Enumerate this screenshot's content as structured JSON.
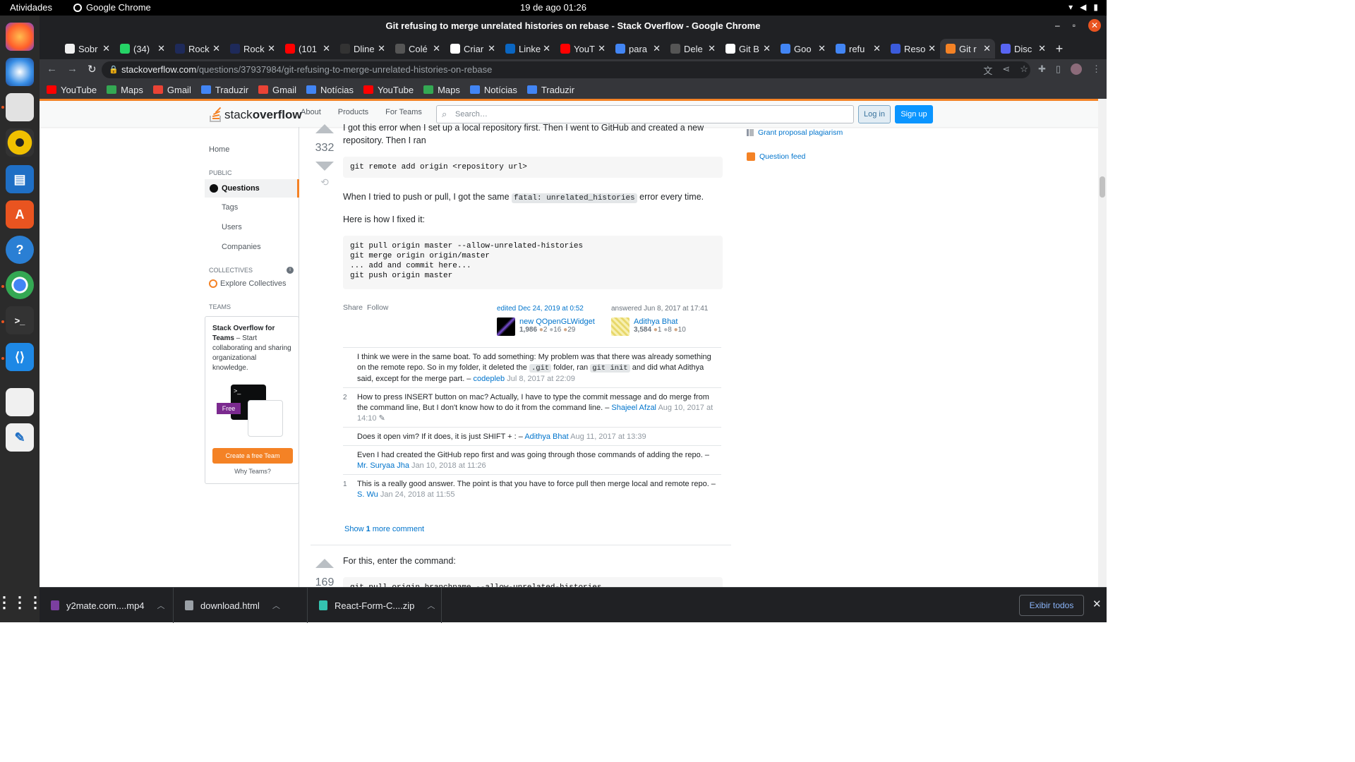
{
  "os": {
    "activities": "Atividades",
    "app_name": "Google Chrome",
    "clock": "19 de ago  01:26"
  },
  "window": {
    "title": "Git refusing to merge unrelated histories on rebase - Stack Overflow - Google Chrome"
  },
  "tabs": [
    {
      "label": "Sobr",
      "color": "#f0f0f0"
    },
    {
      "label": "(34)",
      "color": "#25d366"
    },
    {
      "label": "Rock",
      "color": "#1e2a5a"
    },
    {
      "label": "Rock",
      "color": "#1e2a5a"
    },
    {
      "label": "(101",
      "color": "#ff0000"
    },
    {
      "label": "Dline",
      "color": "#333333"
    },
    {
      "label": "Colé",
      "color": "#555555"
    },
    {
      "label": "Criar",
      "color": "#ffffff"
    },
    {
      "label": "Linke",
      "color": "#0a66c2"
    },
    {
      "label": "YouT",
      "color": "#ff0000"
    },
    {
      "label": "para",
      "color": "#4285f4"
    },
    {
      "label": "Dele",
      "color": "#555555"
    },
    {
      "label": "Git B",
      "color": "#ffffff"
    },
    {
      "label": "Goo",
      "color": "#4285f4"
    },
    {
      "label": "refu",
      "color": "#4285f4"
    },
    {
      "label": "Reso",
      "color": "#3b5bdb"
    },
    {
      "label": "Git r",
      "color": "#f48225"
    },
    {
      "label": "Disc",
      "color": "#5865f2"
    }
  ],
  "omnibox": {
    "host": "stackoverflow.com",
    "path": "/questions/37937984/git-refusing-to-merge-unrelated-histories-on-rebase"
  },
  "bookmarks": [
    {
      "label": "YouTube",
      "color": "#ff0000"
    },
    {
      "label": "Maps",
      "color": "#34a853"
    },
    {
      "label": "Gmail",
      "color": "#ea4335"
    },
    {
      "label": "Traduzir",
      "color": "#4285f4"
    },
    {
      "label": "Gmail",
      "color": "#ea4335"
    },
    {
      "label": "Notícias",
      "color": "#4285f4"
    },
    {
      "label": "YouTube",
      "color": "#ff0000"
    },
    {
      "label": "Maps",
      "color": "#34a853"
    },
    {
      "label": "Notícias",
      "color": "#4285f4"
    },
    {
      "label": "Traduzir",
      "color": "#4285f4"
    }
  ],
  "so": {
    "logo_light": "stack",
    "logo_bold": "overflow",
    "nav": [
      "About",
      "Products",
      "For Teams"
    ],
    "search_placeholder": "Search…",
    "login": "Log in",
    "signup": "Sign up"
  },
  "leftnav": {
    "home": "Home",
    "public": "PUBLIC",
    "questions": "Questions",
    "tags": "Tags",
    "users": "Users",
    "companies": "Companies",
    "collectives": "COLLECTIVES",
    "explore": "Explore Collectives",
    "teams": "TEAMS",
    "teams_title": "Stack Overflow for Teams",
    "teams_desc": " – Start collaborating and sharing organizational knowledge.",
    "free": "Free",
    "create_team": "Create a free Team",
    "why_teams": "Why Teams?"
  },
  "answer1": {
    "score": "332",
    "intro_a": "I got this error when I set up a local repository first. Then I went to GitHub and created a new repository. Then I ran",
    "code1": "git remote add origin <repository url>",
    "p2_before": "When I tried to push or pull, I got the same ",
    "p2_code": "fatal: unrelated_histories",
    "p2_after": " error every time.",
    "p3": "Here is how I fixed it:",
    "code2": "git pull origin master --allow-unrelated-histories\ngit merge origin origin/master\n... add and commit here...\ngit push origin master",
    "share": "Share",
    "follow": "Follow",
    "edited": "edited Dec 24, 2019 at 0:52",
    "editor": {
      "name": "new QOpenGLWidget",
      "rep": "1,986",
      "gold": "2",
      "silver": "16",
      "bronze": "29"
    },
    "answered": "answered Jun 8, 2017 at 17:41",
    "author": {
      "name": "Adithya Bhat",
      "rep": "3,584",
      "gold": "1",
      "silver": "8",
      "bronze": "10"
    }
  },
  "comments": [
    {
      "score": "",
      "text_a": "I think we were in the same boat. To add something: My problem was that there was already something on the remote repo. So in my folder, it deleted the ",
      "code_a": ".git",
      "text_b": " folder, ran ",
      "code_b": "git init",
      "text_c": " and did what Adithya said, except for the merge part. – ",
      "user": "codepleb",
      "date": "Jul 8, 2017 at 22:09"
    },
    {
      "score": "2",
      "text": "How to press INSERT button on mac? Actually, I have to type the commit message and do merge from the command line, But I don't know how to do it from the command line. – ",
      "user": "Shajeel Afzal",
      "date": "Aug 10, 2017 at 14:10"
    },
    {
      "score": "",
      "text": "Does it open vim? If it does, it is just SHIFT + : – ",
      "user": "Adithya Bhat",
      "date": "Aug 11, 2017 at 13:39"
    },
    {
      "score": "",
      "text": "Even I had created the GitHub repo first and was going through those commands of adding the repo. – ",
      "user": "Mr. Suryaa Jha",
      "date": "Jan 10, 2018 at 11:26"
    },
    {
      "score": "1",
      "text": "This is a really good answer. The point is that you have to force pull then merge local and remote repo. – ",
      "user": "S. Wu",
      "date": "Jan 24, 2018 at 11:55"
    }
  ],
  "show_more": {
    "prefix": "Show ",
    "count": "1",
    "suffix": " more comment"
  },
  "answer2": {
    "score": "169",
    "text": "For this, enter the command:",
    "code": "git pull origin branchname --allow-unrelated-histories"
  },
  "sidebar": {
    "grant": "Grant proposal plagiarism",
    "feed": "Question feed"
  },
  "downloads": [
    {
      "name": "y2mate.com....mp4",
      "color": "#7b3fa0"
    },
    {
      "name": "download.html",
      "color": "#9aa0a6"
    },
    {
      "name": "React-Form-C....zip",
      "color": "#34c3b0"
    }
  ],
  "show_all": "Exibir todos"
}
